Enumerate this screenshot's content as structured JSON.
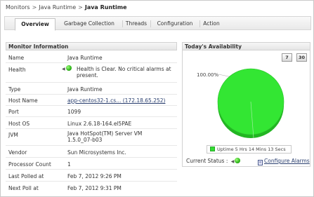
{
  "breadcrumb": {
    "items": [
      "Monitors",
      "Java Runtime"
    ],
    "current": "Java Runtime"
  },
  "tabs": [
    {
      "label": "Overview",
      "active": true
    },
    {
      "label": "Garbage Collection",
      "active": false
    },
    {
      "label": "Threads",
      "active": false
    },
    {
      "label": "Configuration",
      "active": false
    },
    {
      "label": "Action",
      "active": false
    }
  ],
  "monitor_info": {
    "title": "Monitor Information",
    "rows": [
      {
        "label": "Name",
        "value": "Java Runtime"
      },
      {
        "label": "Health",
        "value": "Health is Clear. No critical alarms at present."
      },
      {
        "label": "Type",
        "value": "Java Runtime"
      },
      {
        "label": "Host Name",
        "value": "app-centos32-1.cs... (172.18.65.252)"
      },
      {
        "label": "Port",
        "value": "1099"
      },
      {
        "label": "Host OS",
        "value": "Linux 2.6.18-164.el5PAE"
      },
      {
        "label": "JVM",
        "value": "Java HotSpot(TM) Server VM 1.5.0_07-b03"
      },
      {
        "label": "Vendor",
        "value": "Sun Microsystems Inc."
      },
      {
        "label": "Processor Count",
        "value": "1"
      },
      {
        "label": "Last Polled at",
        "value": "Feb 7, 2012 9:26 PM"
      },
      {
        "label": "Next Poll at",
        "value": "Feb 7, 2012 9:31 PM"
      }
    ]
  },
  "availability": {
    "title": "Today's Availability",
    "period_buttons": [
      "7",
      "30"
    ],
    "percent_label": "100.00%",
    "legend": "Uptime 5 Hrs 14 Mins 13 Secs",
    "current_status_label": "Current Status :",
    "configure_label": "Configure Alarms"
  },
  "colors": {
    "pie_green": "#33e633",
    "health_green": "#2fb51a",
    "link": "#2a3f6f"
  },
  "chart_data": {
    "type": "pie",
    "title": "",
    "slices": [
      {
        "name": "Uptime 5 Hrs 14 Mins 13 Secs",
        "value": 100.0
      }
    ],
    "labels": [
      "100.00%"
    ],
    "legend_position": "bottom"
  }
}
